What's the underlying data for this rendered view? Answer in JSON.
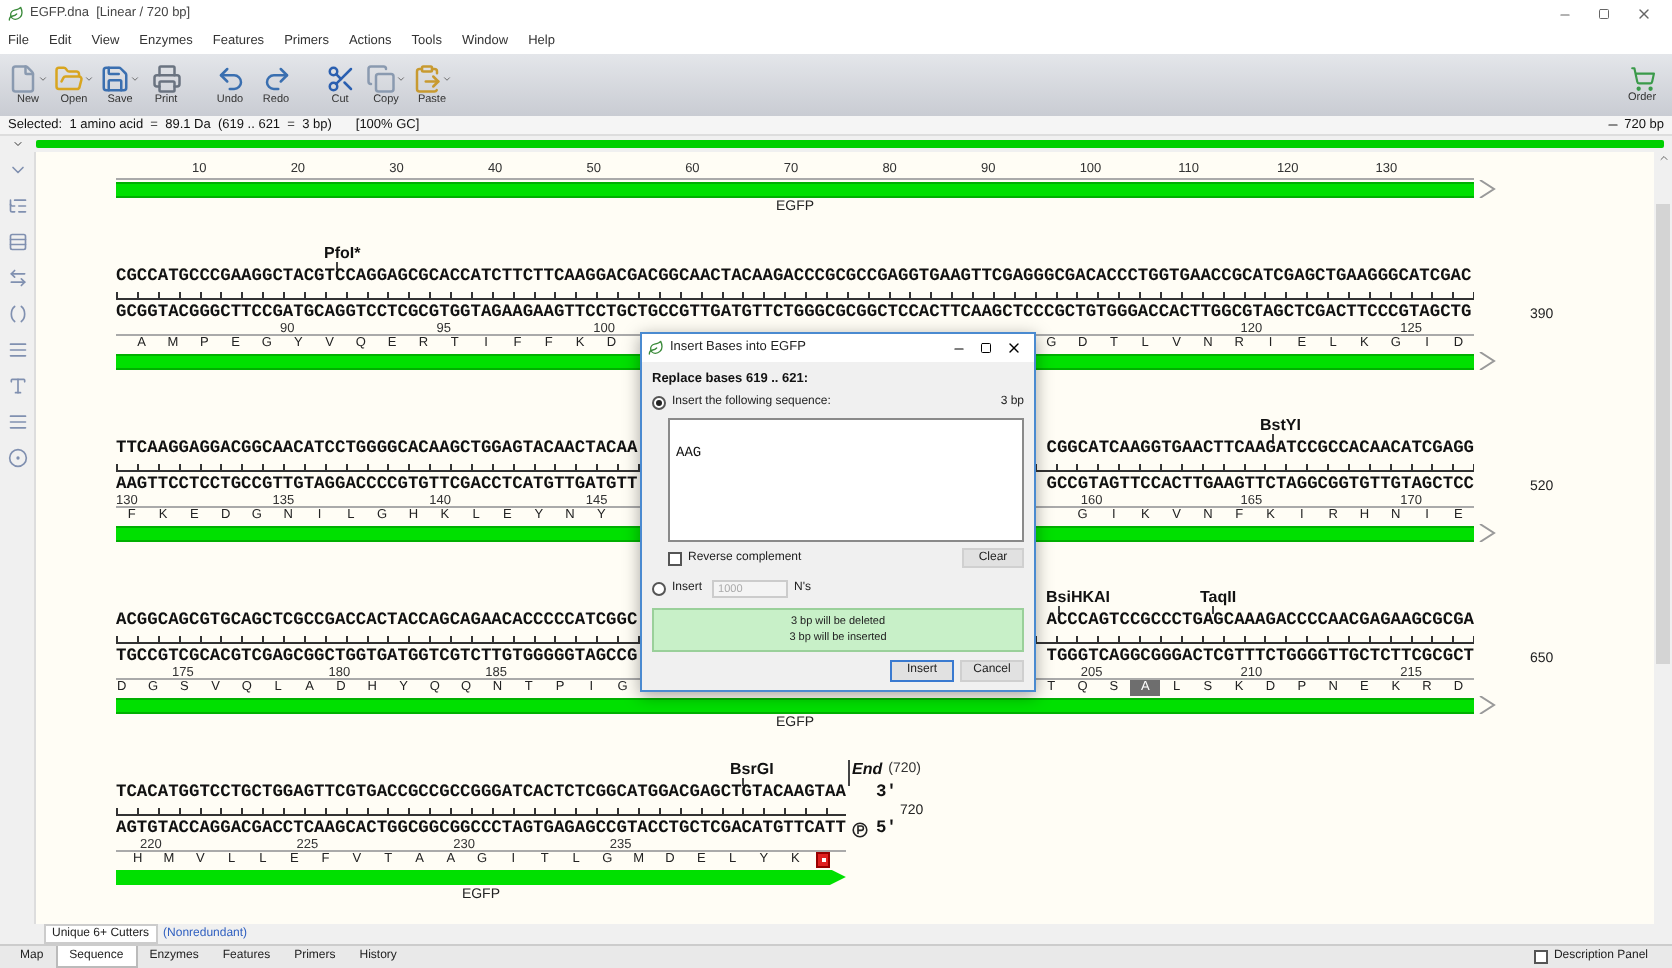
{
  "window": {
    "title": "EGFP.dna  [Linear / 720 bp]"
  },
  "menu": [
    "File",
    "Edit",
    "View",
    "Enzymes",
    "Features",
    "Primers",
    "Actions",
    "Tools",
    "Window",
    "Help"
  ],
  "toolbar": [
    [
      {
        "label": "New",
        "kind": "new",
        "has_menu": true
      },
      {
        "label": "Open",
        "kind": "open",
        "has_menu": true
      },
      {
        "label": "Save",
        "kind": "save",
        "has_menu": true
      },
      {
        "label": "Print",
        "kind": "print",
        "has_menu": false
      }
    ],
    [
      {
        "label": "Undo",
        "kind": "undo",
        "has_menu": false
      },
      {
        "label": "Redo",
        "kind": "redo",
        "has_menu": false
      }
    ],
    [
      {
        "label": "Cut",
        "kind": "cut",
        "has_menu": false
      },
      {
        "label": "Copy",
        "kind": "copy",
        "has_menu": true
      },
      {
        "label": "Paste",
        "kind": "paste",
        "has_menu": true
      }
    ]
  ],
  "order_button": {
    "label": "Order"
  },
  "status": {
    "selection": "Selected:  1 amino acid  =  89.1 Da  (619 .. 621  =  3 bp)",
    "gc": "[100% GC]",
    "length": "720 bp"
  },
  "top_row": {
    "ruler": [
      "10",
      "20",
      "30",
      "40",
      "50",
      "60",
      "70",
      "80",
      "90",
      "100",
      "110",
      "120",
      "130"
    ],
    "feature_label": "EGFP",
    "feature_continues": true
  },
  "rows": [
    {
      "enzymes": [
        {
          "name": "PfoI*"
        }
      ],
      "top": [
        "CGCCATGCCCGAAGGCTACGTCCAGGAGCGCACCATCTTCTTCAAGGACGACGGCAACTACAAGACCCGCGCCGAGGTGAAGTTCGAGGGCGACACCCTGGTGAACCGCATCGAGCTGAAGGGCATCGAC"
      ],
      "bottom": [
        "GCGGTACGGGCTTCCGATGCAGGTCCTCGCGTGGTAGAAGAAGTTCCTGCTGCCGTTGATGTTCTGGGCGCGGCTCCACTTCAAGCTCCCGCTGTGGGACCACTTGGCGTAGCTCGACTTCCCGTAGCTG"
      ],
      "ruler": [
        [
          "90",
          "95",
          "100"
        ],
        [
          "120",
          "125"
        ]
      ],
      "amino_acids": [
        [
          {
            "code": "A",
            "selected": false
          },
          {
            "code": "M",
            "selected": false
          },
          {
            "code": "P",
            "selected": false
          },
          {
            "code": "E",
            "selected": false
          },
          {
            "code": "G",
            "selected": false
          },
          {
            "code": "Y",
            "selected": false
          },
          {
            "code": "V",
            "selected": false
          },
          {
            "code": "Q",
            "selected": false
          },
          {
            "code": "E",
            "selected": false
          },
          {
            "code": "R",
            "selected": false
          },
          {
            "code": "T",
            "selected": false
          },
          {
            "code": "I",
            "selected": false
          },
          {
            "code": "F",
            "selected": false
          },
          {
            "code": "F",
            "selected": false
          },
          {
            "code": "K",
            "selected": false
          },
          {
            "code": "D",
            "selected": false
          }
        ],
        [
          {
            "code": "G",
            "selected": false
          },
          {
            "code": "D",
            "selected": false
          },
          {
            "code": "T",
            "selected": false
          },
          {
            "code": "L",
            "selected": false
          },
          {
            "code": "V",
            "selected": false
          },
          {
            "code": "N",
            "selected": false
          },
          {
            "code": "R",
            "selected": false
          },
          {
            "code": "I",
            "selected": false
          },
          {
            "code": "E",
            "selected": false
          },
          {
            "code": "L",
            "selected": false
          },
          {
            "code": "K",
            "selected": false
          },
          {
            "code": "G",
            "selected": false
          },
          {
            "code": "I",
            "selected": false
          },
          {
            "code": "D",
            "selected": false
          }
        ]
      ],
      "feature_continues": true,
      "number": "390"
    },
    {
      "enzymes": [
        {
          "name": "BstYI"
        }
      ],
      "top": [
        "TTCAAGGAGGACGGCAACATCCTGGGGCACAAGCTGGAGTACAACTACAA",
        "CGGCATCAAGGTGAACTTCAAGATCCGCCACAACATCGAGG"
      ],
      "bottom": [
        "AAGTTCCTCCTGCCGTTGTAGGACCCCGTGTTCGACCTCATGTTGATGTT",
        "GCCGTAGTTCCACTTGAAGTTCTAGGCGGTGTTGTAGCTCC"
      ],
      "ruler": [
        [
          "130",
          "135",
          "140",
          "145"
        ],
        [
          "160",
          "165",
          "170"
        ]
      ],
      "amino_acids": [
        [
          {
            "code": "F",
            "selected": false
          },
          {
            "code": "K",
            "selected": false
          },
          {
            "code": "E",
            "selected": false
          },
          {
            "code": "D",
            "selected": false
          },
          {
            "code": "G",
            "selected": false
          },
          {
            "code": "N",
            "selected": false
          },
          {
            "code": "I",
            "selected": false
          },
          {
            "code": "L",
            "selected": false
          },
          {
            "code": "G",
            "selected": false
          },
          {
            "code": "H",
            "selected": false
          },
          {
            "code": "K",
            "selected": false
          },
          {
            "code": "L",
            "selected": false
          },
          {
            "code": "E",
            "selected": false
          },
          {
            "code": "Y",
            "selected": false
          },
          {
            "code": "N",
            "selected": false
          },
          {
            "code": "Y",
            "selected": false
          }
        ],
        [
          {
            "code": "G",
            "selected": false
          },
          {
            "code": "I",
            "selected": false
          },
          {
            "code": "K",
            "selected": false
          },
          {
            "code": "V",
            "selected": false
          },
          {
            "code": "N",
            "selected": false
          },
          {
            "code": "F",
            "selected": false
          },
          {
            "code": "K",
            "selected": false
          },
          {
            "code": "I",
            "selected": false
          },
          {
            "code": "R",
            "selected": false
          },
          {
            "code": "H",
            "selected": false
          },
          {
            "code": "N",
            "selected": false
          },
          {
            "code": "I",
            "selected": false
          },
          {
            "code": "E",
            "selected": false
          }
        ]
      ],
      "feature_continues": true,
      "number": "520"
    },
    {
      "enzymes": [
        {
          "name": "BsiHKAI"
        },
        {
          "name": "TaqII"
        }
      ],
      "top": [
        "ACGGCAGCGTGCAGCTCGCCGACCACTACCAGCAGAACACCCCCATCGGC",
        "ACCCAGTCCGCCCTGAGCAAAGACCCCAACGAGAAGCGCGA"
      ],
      "bottom": [
        "TGCCGTCGCACGTCGAGCGGCTGGTGATGGTCGTCTTGTGGGGGTAGCCG",
        "TGGGTCAGGCGGGACTCGTTTCTGGGGTTGCTCTTCGCGCT"
      ],
      "ruler": [
        [
          "175",
          "180",
          "185"
        ],
        [
          "205",
          "210",
          "215"
        ]
      ],
      "amino_acids": [
        [
          {
            "code": "D",
            "selected": false
          },
          {
            "code": "G",
            "selected": false
          },
          {
            "code": "S",
            "selected": false
          },
          {
            "code": "V",
            "selected": false
          },
          {
            "code": "Q",
            "selected": false
          },
          {
            "code": "L",
            "selected": false
          },
          {
            "code": "A",
            "selected": false
          },
          {
            "code": "D",
            "selected": false
          },
          {
            "code": "H",
            "selected": false
          },
          {
            "code": "Y",
            "selected": false
          },
          {
            "code": "Q",
            "selected": false
          },
          {
            "code": "Q",
            "selected": false
          },
          {
            "code": "N",
            "selected": false
          },
          {
            "code": "T",
            "selected": false
          },
          {
            "code": "P",
            "selected": false
          },
          {
            "code": "I",
            "selected": false
          },
          {
            "code": "G",
            "selected": false
          }
        ],
        [
          {
            "code": "T",
            "selected": false
          },
          {
            "code": "Q",
            "selected": false
          },
          {
            "code": "S",
            "selected": false
          },
          {
            "code": "A",
            "selected": true
          },
          {
            "code": "L",
            "selected": false
          },
          {
            "code": "S",
            "selected": false
          },
          {
            "code": "K",
            "selected": false
          },
          {
            "code": "D",
            "selected": false
          },
          {
            "code": "P",
            "selected": false
          },
          {
            "code": "N",
            "selected": false
          },
          {
            "code": "E",
            "selected": false
          },
          {
            "code": "K",
            "selected": false
          },
          {
            "code": "R",
            "selected": false
          },
          {
            "code": "D",
            "selected": false
          }
        ]
      ],
      "feature_continues": true,
      "feature_label": "EGFP",
      "number": "650"
    },
    {
      "enzymes": [
        {
          "name": "BsrGI"
        }
      ],
      "end_marker": {
        "label": "End",
        "position": "(720)"
      },
      "top": [
        "TCACATGGTCCTGCTGGAGTTCGTGACCGCCGCCGGGATCACTCTCGGCATGGACGAGCTGTACAAGTAA"
      ],
      "bottom": [
        "AGTGTACCAGGACGACCTCAAGCACTGGCGGCGGCCCTAGTGAGAGCCGTACCTGCTCGACATGTTCATT"
      ],
      "ruler": [
        [
          "220",
          "225",
          "230",
          "235"
        ]
      ],
      "amino_acids": [
        [
          {
            "code": "H",
            "selected": false
          },
          {
            "code": "M",
            "selected": false
          },
          {
            "code": "V",
            "selected": false
          },
          {
            "code": "L",
            "selected": false
          },
          {
            "code": "L",
            "selected": false
          },
          {
            "code": "E",
            "selected": false
          },
          {
            "code": "F",
            "selected": false
          },
          {
            "code": "V",
            "selected": false
          },
          {
            "code": "T",
            "selected": false
          },
          {
            "code": "A",
            "selected": false
          },
          {
            "code": "A",
            "selected": false
          },
          {
            "code": "G",
            "selected": false
          },
          {
            "code": "I",
            "selected": false
          },
          {
            "code": "T",
            "selected": false
          },
          {
            "code": "L",
            "selected": false
          },
          {
            "code": "G",
            "selected": false
          },
          {
            "code": "M",
            "selected": false
          },
          {
            "code": "D",
            "selected": false
          },
          {
            "code": "E",
            "selected": false
          },
          {
            "code": "L",
            "selected": false
          },
          {
            "code": "Y",
            "selected": false
          },
          {
            "code": "K",
            "selected": false
          }
        ]
      ],
      "stop_marker": true,
      "feature_continues": false,
      "feature_label": "EGFP",
      "number": "720",
      "strand_ends": {
        "top": "3'",
        "bottom": "5'"
      }
    }
  ],
  "dialog": {
    "title": "Insert Bases into EGFP",
    "heading": "Replace bases 619 .. 621:",
    "options": [
      {
        "kind": "sequence",
        "label": "Insert the following sequence:",
        "selected": true,
        "note": "3 bp"
      },
      {
        "kind": "count",
        "label": "Insert",
        "selected": false,
        "count": "1000",
        "unit": "N's"
      }
    ],
    "sequence": "AAG",
    "reverse_complement": {
      "label": "Reverse complement",
      "checked": false
    },
    "clear_button": "Clear",
    "summary": [
      "3 bp will be deleted",
      "3 bp will be inserted"
    ],
    "buttons": [
      "Insert",
      "Cancel"
    ]
  },
  "cutters_tab": {
    "label": "Unique 6+ Cutters",
    "link": "(Nonredundant)"
  },
  "bottom_tabs": [
    {
      "label": "Map",
      "selected": false
    },
    {
      "label": "Sequence",
      "selected": true
    },
    {
      "label": "Enzymes",
      "selected": false
    },
    {
      "label": "Features",
      "selected": false
    },
    {
      "label": "Primers",
      "selected": false
    },
    {
      "label": "History",
      "selected": false
    }
  ],
  "description_panel": {
    "label": "Description Panel",
    "checked": false
  }
}
